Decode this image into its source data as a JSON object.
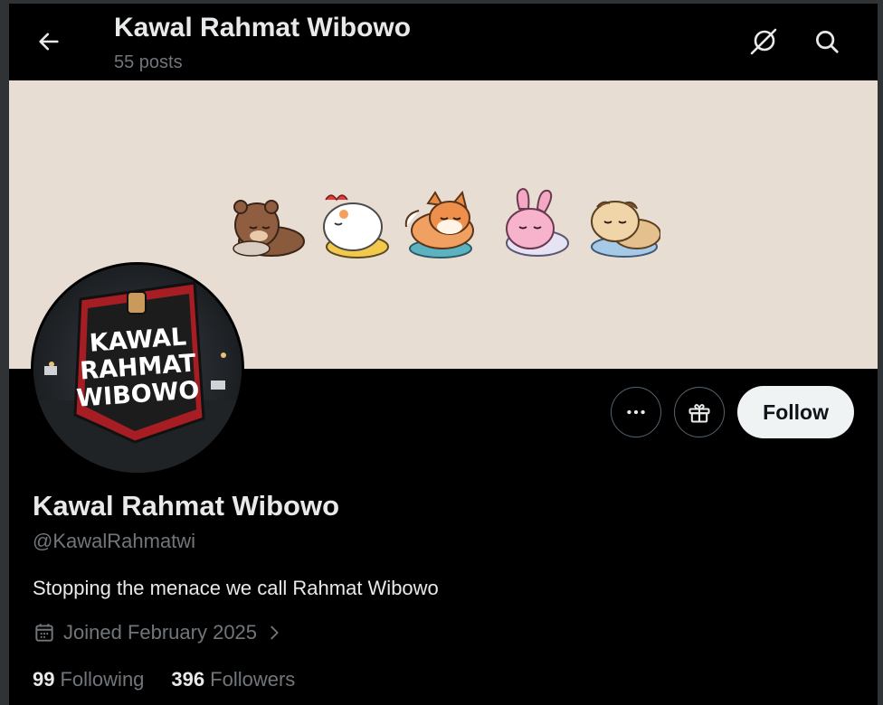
{
  "header": {
    "title": "Kawal Rahmat Wibowo",
    "post_count": "55 posts",
    "back_icon": "arrow-left-icon",
    "grok_icon": "grok-icon",
    "search_icon": "search-icon"
  },
  "banner": {
    "background_color": "#e8ddd2",
    "stickers": [
      "bear",
      "chick",
      "fox",
      "bunny",
      "puppy"
    ]
  },
  "avatar": {
    "logo_lines": [
      "KAWAL",
      "RAHMAT",
      "WIBOWO"
    ]
  },
  "actions": {
    "more_icon": "more-icon",
    "gift_icon": "gift-icon",
    "follow_label": "Follow"
  },
  "profile": {
    "name": "Kawal Rahmat Wibowo",
    "handle": "@KawalRahmatwi",
    "bio": "Stopping the menace we call Rahmat Wibowo",
    "joined": "Joined February 2025"
  },
  "stats": {
    "following_count": "99",
    "following_label": "Following",
    "followers_count": "396",
    "followers_label": "Followers"
  },
  "colors": {
    "background": "#000000",
    "text_primary": "#e7e9ea",
    "text_secondary": "#71767b",
    "follow_bg": "#eff3f4",
    "border": "#536471"
  }
}
